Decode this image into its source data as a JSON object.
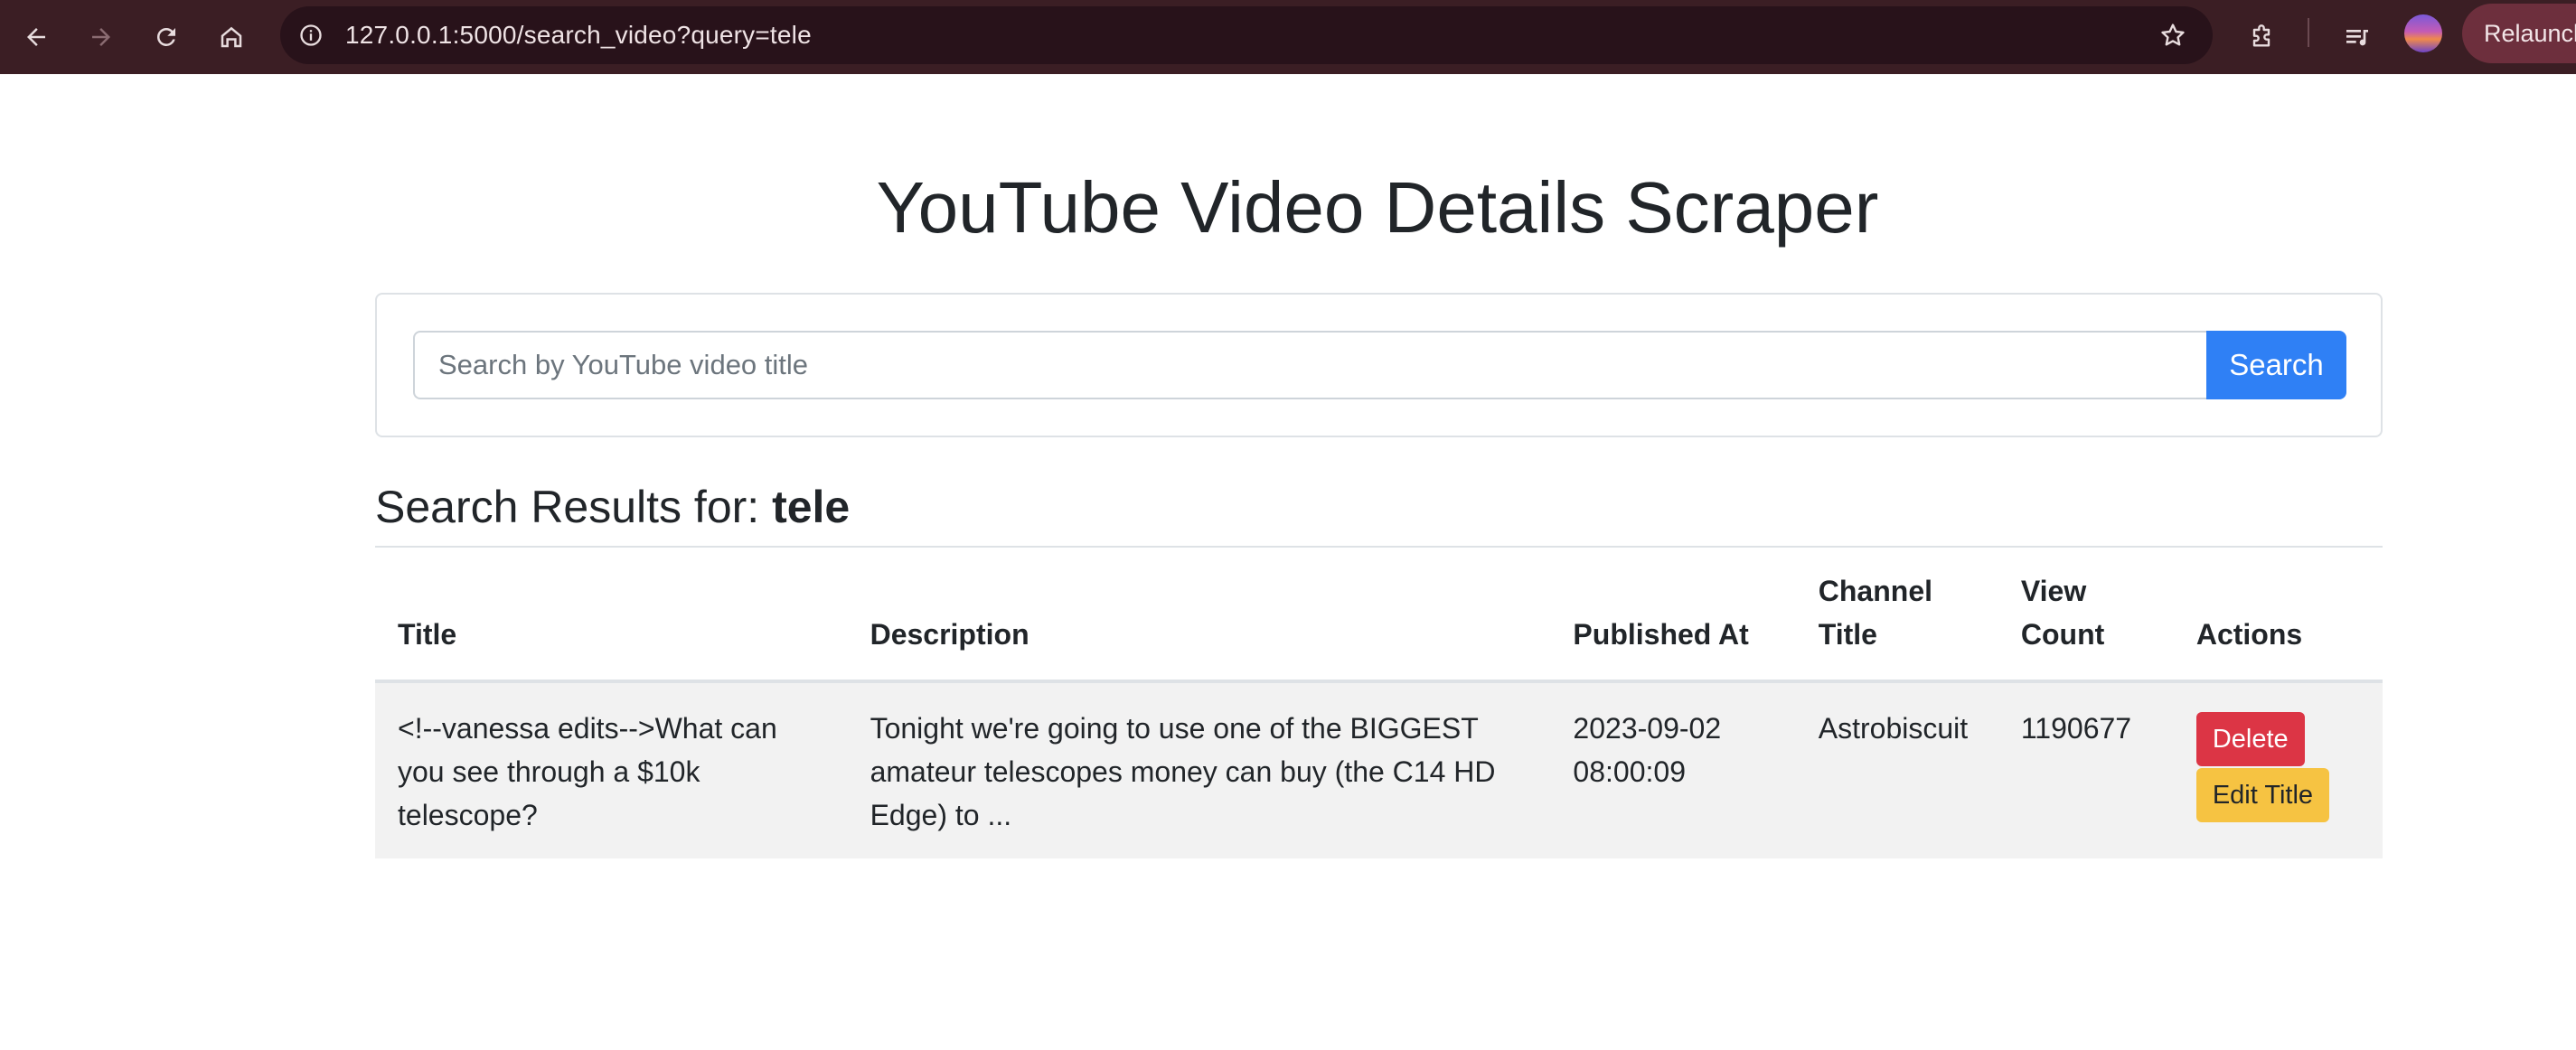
{
  "browser": {
    "url": "127.0.0.1:5000/search_video?query=tele",
    "relaunch_label": "Relaunch"
  },
  "icons": {
    "back": "back-arrow-icon",
    "forward": "forward-arrow-icon",
    "reload": "reload-icon",
    "home": "home-icon",
    "site_info": "info-icon",
    "bookmark": "star-icon",
    "extensions": "puzzle-icon",
    "media": "media-queue-icon",
    "profile": "avatar"
  },
  "colors": {
    "toolbar_bg": "#3b1e24",
    "search_button": "#2f80f5",
    "delete_button": "#dc3545",
    "edit_button": "#f6c342",
    "row_bg": "#f2f2f2"
  },
  "page": {
    "title": "YouTube Video Details Scraper"
  },
  "search": {
    "placeholder": "Search by YouTube video title",
    "value": "",
    "button_label": "Search"
  },
  "results": {
    "heading_prefix": "Search Results for:",
    "query": "tele",
    "columns": [
      "Title",
      "Description",
      "Published At",
      "Channel Title",
      "View Count",
      "Actions"
    ],
    "rows": [
      {
        "title": "<!--vanessa edits-->What can you see through a $10k telescope?",
        "description": "Tonight we're going to use one of the BIGGEST amateur telescopes money can buy (the C14 HD Edge) to ...",
        "published_at": "2023-09-02 08:00:09",
        "channel_title": "Astrobiscuit",
        "view_count": "1190677",
        "delete_label": "Delete",
        "edit_label": "Edit Title"
      }
    ]
  }
}
